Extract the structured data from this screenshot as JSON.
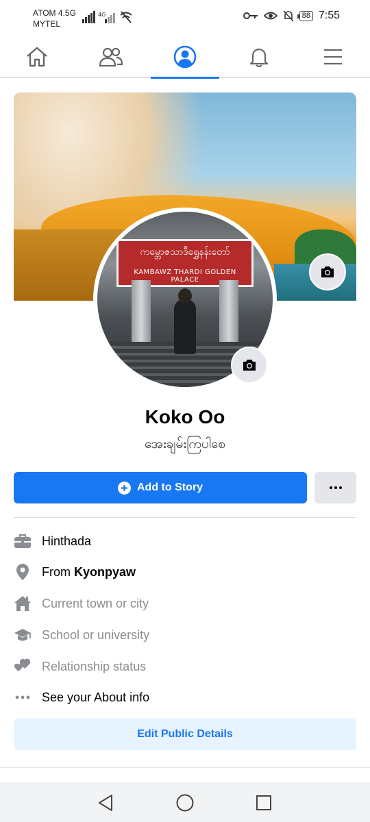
{
  "status_bar": {
    "carrier_line1": "ATOM 4.5G",
    "carrier_line2": "MYTEL",
    "network_badge": "4G",
    "battery": "88",
    "time": "7:55"
  },
  "nav": {
    "items": [
      {
        "name": "home",
        "icon": "home-icon"
      },
      {
        "name": "friends",
        "icon": "friends-icon"
      },
      {
        "name": "profile",
        "icon": "profile-icon",
        "active": true
      },
      {
        "name": "notifications",
        "icon": "bell-icon"
      },
      {
        "name": "menu",
        "icon": "hamburger-icon"
      }
    ],
    "accent": "#1877f2"
  },
  "cover": {
    "sign_text_myanmar": "ကမ္ဘောဇသာဒီရွှေနန်းတော်",
    "sign_text_latin": "KAMBAWZ THARDI GOLDEN PALACE"
  },
  "profile": {
    "name": "Koko Oo",
    "bio": "အေးချမ်းကြပါစေ"
  },
  "actions": {
    "add_story": "Add to Story",
    "more": "•••"
  },
  "details": [
    {
      "icon": "briefcase-icon",
      "text": "Hinthada",
      "muted": false
    },
    {
      "icon": "location-pin-icon",
      "prefix": "From ",
      "bold": "Kyonpyaw",
      "muted": false
    },
    {
      "icon": "house-icon",
      "text": "Current town or city",
      "muted": true
    },
    {
      "icon": "graduation-cap-icon",
      "text": "School or university",
      "muted": true
    },
    {
      "icon": "hearts-icon",
      "text": "Relationship status",
      "muted": true
    },
    {
      "icon": "more-dots-icon",
      "text": "See your About info",
      "muted": false
    }
  ],
  "edit_public_details": "Edit Public Details",
  "colors": {
    "primary": "#1877f2",
    "secondary_button": "#e4e6eb",
    "muted_text": "#8a8d91",
    "icon_gray": "#8a8d91"
  }
}
